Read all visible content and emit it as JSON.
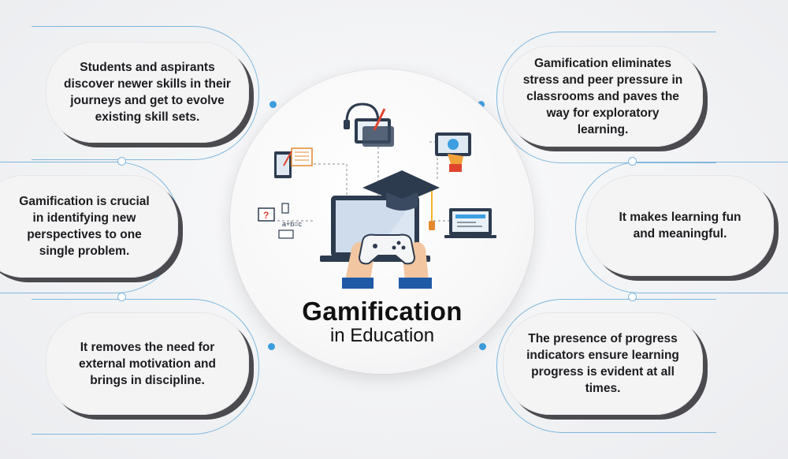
{
  "center": {
    "title": "Gamification",
    "subtitle": "in Education",
    "equation": "a+b=c",
    "question_mark": "?"
  },
  "left_items": [
    {
      "text": "Students and aspirants discover newer skills in their journeys and get to evolve existing skill sets."
    },
    {
      "text": "Gamification is crucial in identifying new perspectives to one single problem."
    },
    {
      "text": "It removes the need for external motivation and brings in discipline."
    }
  ],
  "right_items": [
    {
      "text": "Gamification eliminates stress and peer pressure in classrooms and paves the way for exploratory learning."
    },
    {
      "text": "It makes learning fun and meaningful."
    },
    {
      "text": "The presence of progress indicators ensure learning progress is evident at all times."
    }
  ],
  "colors": {
    "accent": "#3e9fe0",
    "outline": "#7fb8de",
    "dark": "#4a4a4f"
  }
}
